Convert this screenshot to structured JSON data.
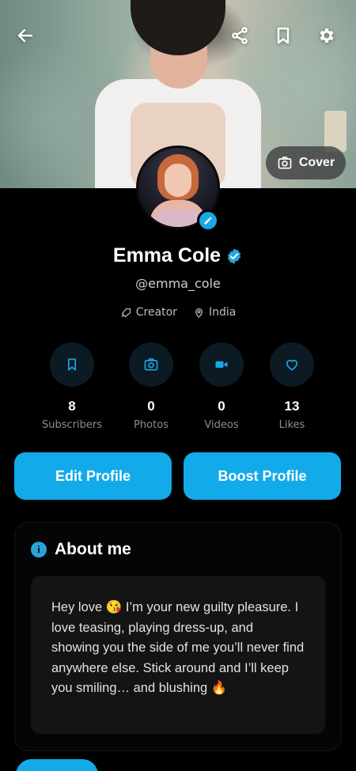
{
  "profile": {
    "name": "Emma Cole",
    "handle": "@emma_cole",
    "role": "Creator",
    "location": "India"
  },
  "cover": {
    "button_label": "Cover"
  },
  "stats": [
    {
      "value": "8",
      "label": "Subscribers",
      "icon": "bookmark-icon"
    },
    {
      "value": "0",
      "label": "Photos",
      "icon": "camera-icon"
    },
    {
      "value": "0",
      "label": "Videos",
      "icon": "video-icon"
    },
    {
      "value": "13",
      "label": "Likes",
      "icon": "heart-icon"
    }
  ],
  "actions": {
    "edit_label": "Edit Profile",
    "boost_label": "Boost Profile"
  },
  "about": {
    "title": "About me",
    "info_glyph": "i",
    "text": "Hey love 😘 I’m your new guilty pleasure. I love teasing, playing dress-up, and showing you the side of me you’ll never find anywhere else. Stick around and I’ll keep you smiling… and blushing 🔥"
  },
  "colors": {
    "accent": "#13aaea",
    "background": "#000000"
  }
}
